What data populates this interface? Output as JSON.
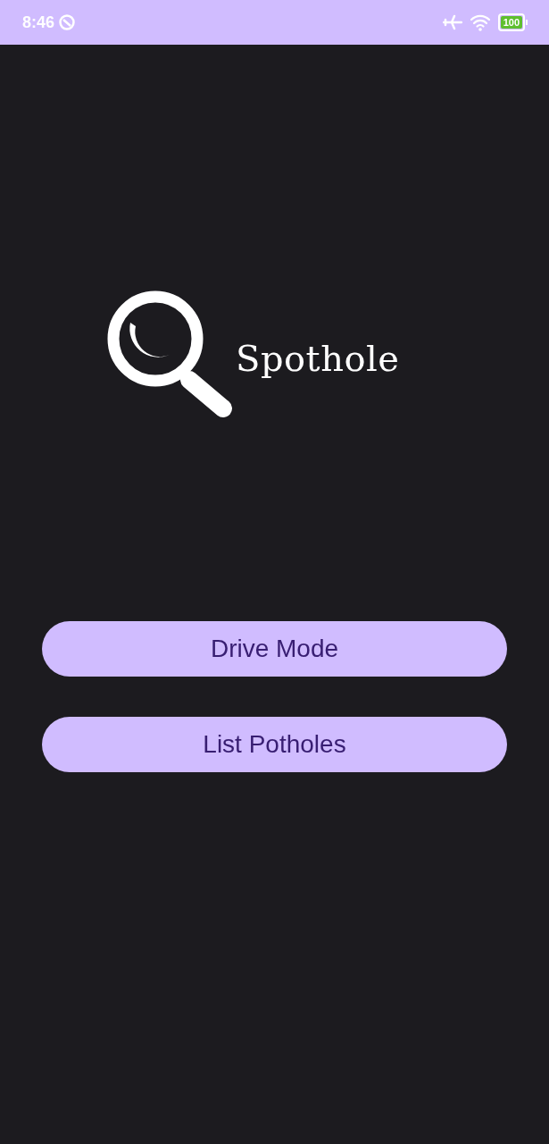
{
  "status_bar": {
    "time": "8:46",
    "battery": "100"
  },
  "logo": {
    "name": "Spothole"
  },
  "buttons": [
    {
      "label": "Drive Mode"
    },
    {
      "label": "List Potholes"
    }
  ]
}
